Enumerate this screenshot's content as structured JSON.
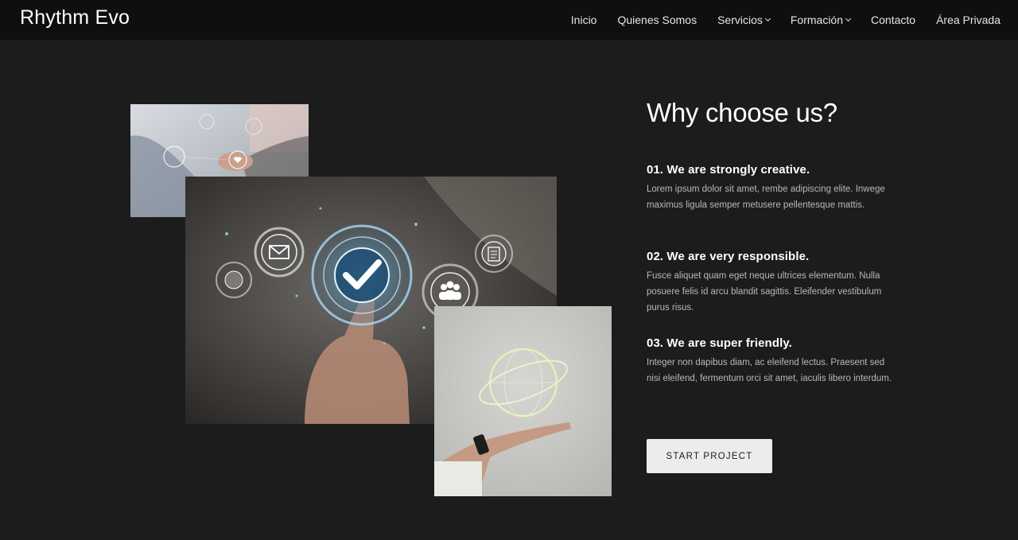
{
  "header": {
    "brand": "Rhythm Evo",
    "nav": [
      {
        "label": "Inicio",
        "dropdown": false
      },
      {
        "label": "Quienes Somos",
        "dropdown": false
      },
      {
        "label": "Servicios",
        "dropdown": true
      },
      {
        "label": "Formación",
        "dropdown": true
      },
      {
        "label": "Contacto",
        "dropdown": false
      },
      {
        "label": "Área Privada",
        "dropdown": false
      }
    ]
  },
  "section": {
    "title": "Why choose us?",
    "features": [
      {
        "heading": "01. We are strongly creative.",
        "text": "Lorem ipsum dolor sit amet, rembe adipiscing elite. Inwege maximus ligula semper metusere pellentesque mattis."
      },
      {
        "heading": "02. We are very responsible.",
        "text": "Fusce aliquet quam eget neque ultrices elementum. Nulla posuere felis id arcu blandit sagittis. Eleifender vestibulum purus risus."
      },
      {
        "heading": "03. We are super friendly.",
        "text": "Integer non dapibus diam, ac eleifend lectus. Praesent sed nisi eleifend, fermentum orci sit amet, iaculis libero interdum."
      }
    ],
    "cta_label": "START PROJECT"
  },
  "colors": {
    "page_background": "#1c1c1c",
    "navbar_background": "#0f0f0f",
    "button_background": "#ececec",
    "body_text": "#b9b9b9"
  },
  "images": [
    {
      "name": "handshake-photo",
      "icon": "heart-icon"
    },
    {
      "name": "touch-checkmark-photo",
      "icons": [
        "envelope-icon",
        "checkmark-icon",
        "globe-icon",
        "people-icon",
        "document-icon"
      ]
    },
    {
      "name": "hand-holding-globe-photo",
      "icon": "globe-icon"
    }
  ]
}
